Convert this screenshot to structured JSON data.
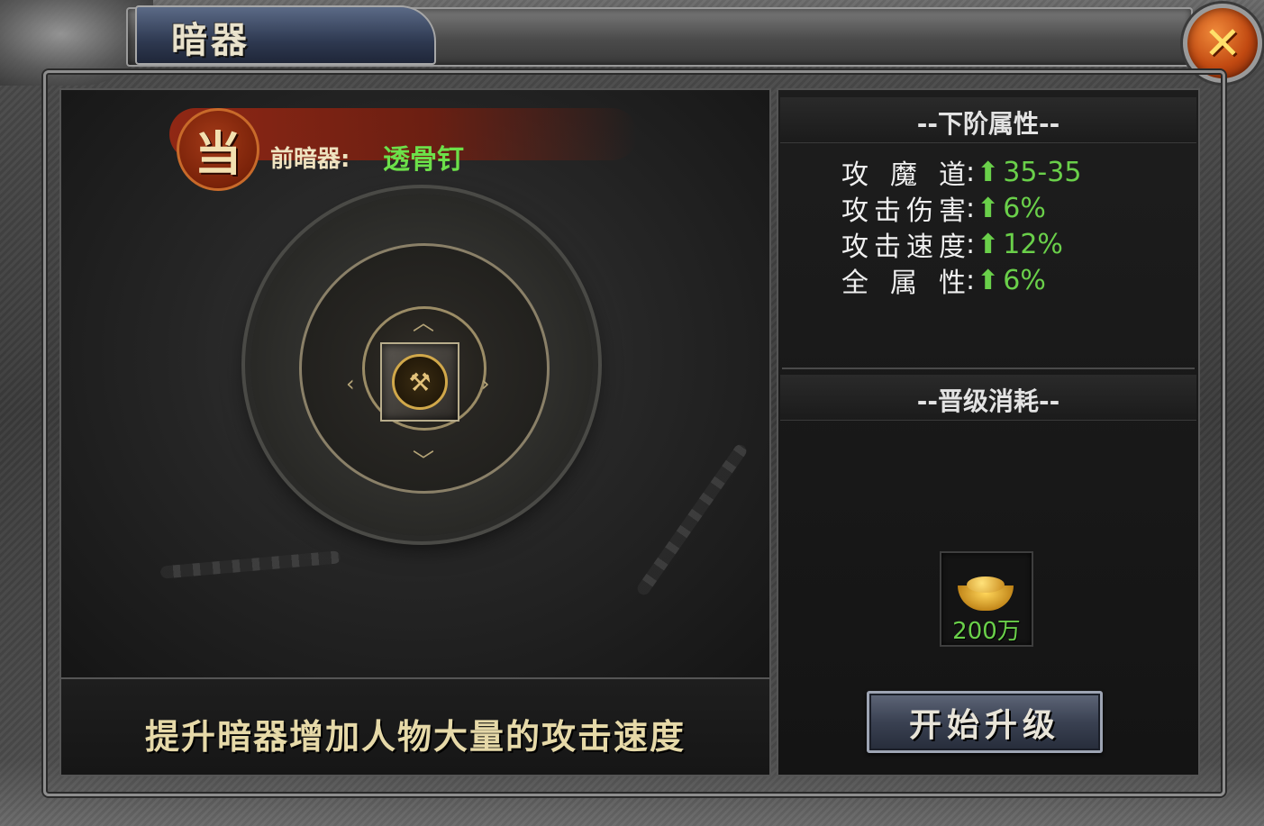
{
  "window": {
    "title": "暗器",
    "close_glyph": "✕"
  },
  "current": {
    "seal_char": "当",
    "label": "前暗器:",
    "value": "透骨钉"
  },
  "description": "提升暗器增加人物大量的攻击速度",
  "next_attributes": {
    "heading": "--下阶属性--",
    "rows": [
      {
        "label": "攻魔道",
        "value": "35-35",
        "trend": "up-arrow-icon"
      },
      {
        "label": "攻击伤害",
        "value": "6%",
        "trend": "up-arrow-icon"
      },
      {
        "label": "攻击速度",
        "value": "12%",
        "trend": "up-arrow-icon"
      },
      {
        "label": "全属性",
        "value": "6%",
        "trend": "up-arrow-icon"
      }
    ],
    "colon": ":",
    "arrow_glyph": "⬆"
  },
  "upgrade_cost": {
    "heading": "--晋级消耗--",
    "item_icon": "gold-ingot-icon",
    "amount": "200万"
  },
  "upgrade_button": {
    "label": "开始升级"
  },
  "colors": {
    "value_green": "#6ad04a",
    "title_cream": "#e9e2cc",
    "close_orange": "#c24a12"
  }
}
